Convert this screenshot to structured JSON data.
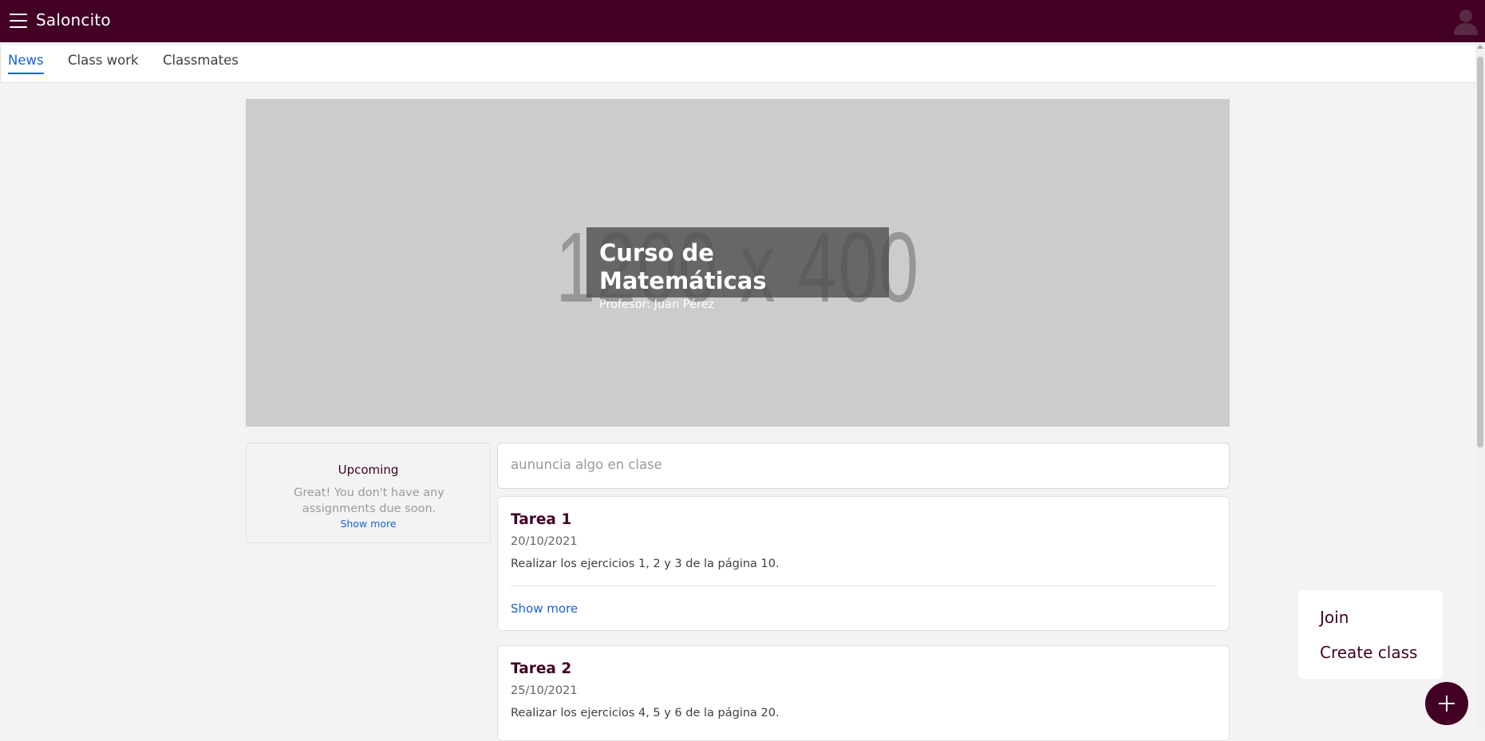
{
  "app": {
    "title": "Saloncito"
  },
  "header": {
    "menu_icon": "menu-icon",
    "avatar_icon": "user-avatar-icon"
  },
  "tabs": [
    {
      "label": "News",
      "active": true
    },
    {
      "label": "Class work",
      "active": false
    },
    {
      "label": "Classmates",
      "active": false
    }
  ],
  "banner": {
    "placeholder": "1200 x 400",
    "title": "Curso de Matemáticas",
    "professor": "Profesor: Juan Pérez"
  },
  "upcoming": {
    "title": "Upcoming",
    "message": "Great! You don't have any assignments due soon.",
    "link": "Show more"
  },
  "announce": {
    "placeholder": "aununcia algo en clase"
  },
  "tasks": [
    {
      "title": "Tarea 1",
      "date": "20/10/2021",
      "description": "Realizar los ejercicios 1, 2 y 3 de la página 10.",
      "link": "Show more"
    },
    {
      "title": "Tarea 2",
      "date": "25/10/2021",
      "description": "Realizar los ejercicios 4, 5 y 6 de la página 20."
    }
  ],
  "fab_menu": {
    "join": "Join",
    "create": "Create class"
  },
  "fab": {
    "icon": "plus-icon"
  },
  "colors": {
    "brand": "#420024",
    "link": "#1a62d6",
    "background": "#f3f3f3"
  }
}
